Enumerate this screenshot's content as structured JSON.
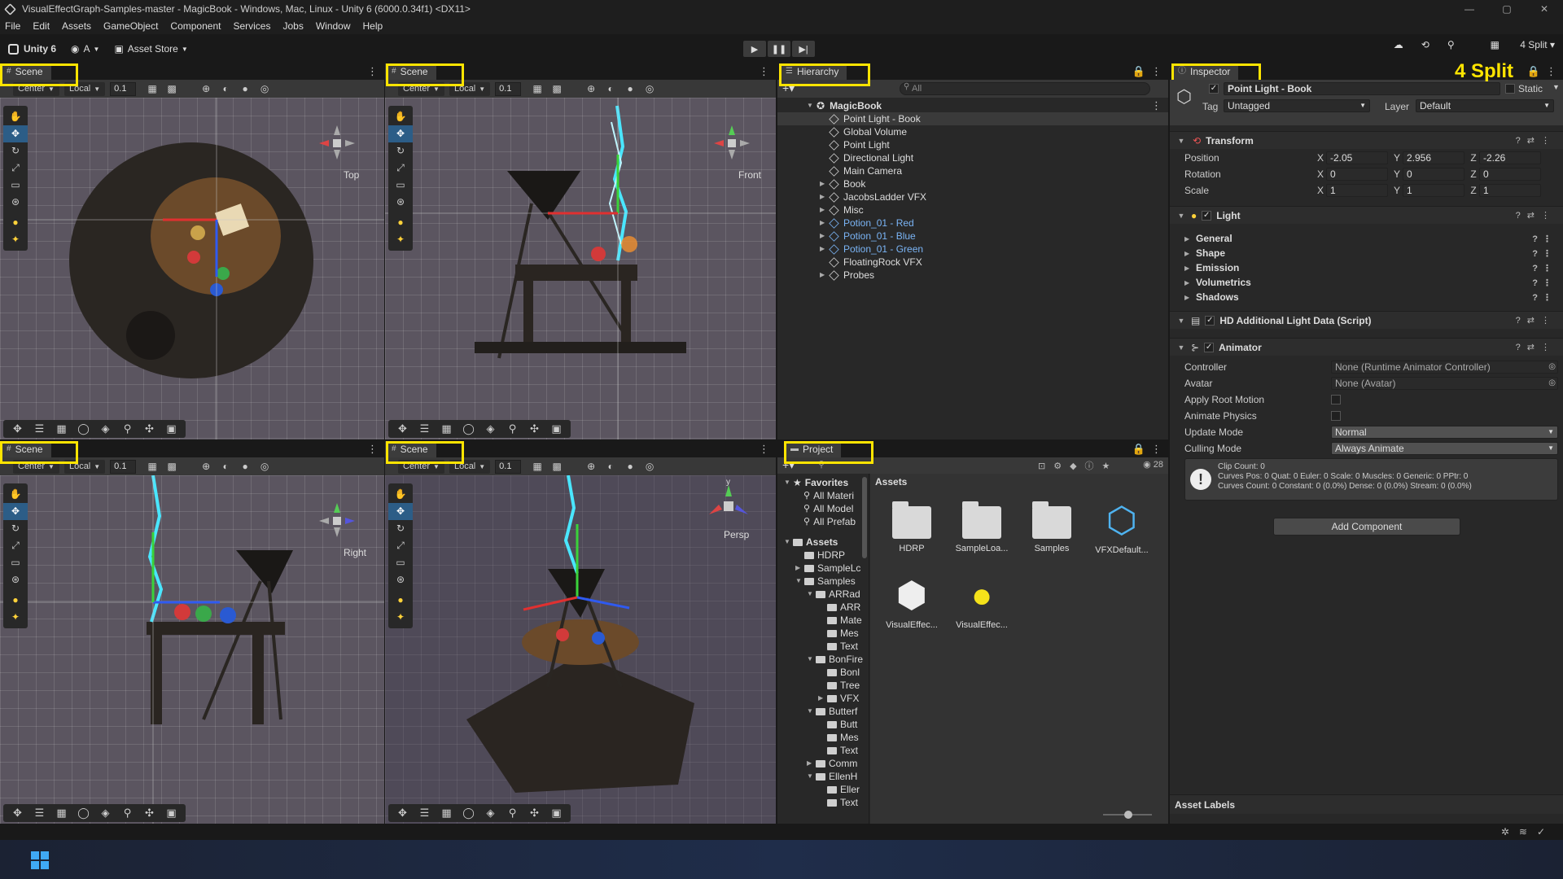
{
  "window": {
    "title": "VisualEffectGraph-Samples-master - MagicBook - Windows, Mac, Linux - Unity 6 (6000.0.34f1) <DX11>",
    "controls": [
      "—",
      "▢",
      "✕"
    ]
  },
  "menu": [
    "File",
    "Edit",
    "Assets",
    "GameObject",
    "Component",
    "Services",
    "Jobs",
    "Window",
    "Help"
  ],
  "toolbar": {
    "account": "Unity 6",
    "user": "A",
    "asset_store": "Asset Store",
    "layout": "4 Split"
  },
  "annotation": "4 Split",
  "scene_views": [
    {
      "tab": "Scene",
      "pivot": "Center",
      "space": "Local",
      "snap": "0.1",
      "gizmo_label": "Top"
    },
    {
      "tab": "Scene",
      "pivot": "Center",
      "space": "Local",
      "snap": "0.1",
      "gizmo_label": "Front"
    },
    {
      "tab": "Scene",
      "pivot": "Center",
      "space": "Local",
      "snap": "0.1",
      "gizmo_label": "Right"
    },
    {
      "tab": "Scene",
      "pivot": "Center",
      "space": "Local",
      "snap": "0.1",
      "gizmo_label": "Persp"
    }
  ],
  "hierarchy": {
    "tab": "Hierarchy",
    "search_placeholder": "All",
    "root": "MagicBook",
    "items": [
      {
        "label": "Point Light - Book",
        "expand": false,
        "prefab": false
      },
      {
        "label": "Global Volume",
        "expand": false,
        "prefab": false
      },
      {
        "label": "Point Light",
        "expand": false,
        "prefab": false
      },
      {
        "label": "Directional Light",
        "expand": false,
        "prefab": false
      },
      {
        "label": "Main Camera",
        "expand": false,
        "prefab": false
      },
      {
        "label": "Book",
        "expand": true,
        "prefab": false
      },
      {
        "label": "JacobsLadder VFX",
        "expand": true,
        "prefab": false
      },
      {
        "label": "Misc",
        "expand": true,
        "prefab": false
      },
      {
        "label": "Potion_01 - Red",
        "expand": true,
        "prefab": true
      },
      {
        "label": "Potion_01 - Blue",
        "expand": true,
        "prefab": true
      },
      {
        "label": "Potion_01 - Green",
        "expand": true,
        "prefab": true
      },
      {
        "label": "FloatingRock VFX",
        "expand": false,
        "prefab": false
      },
      {
        "label": "Probes",
        "expand": true,
        "prefab": false
      }
    ]
  },
  "inspector": {
    "tab": "Inspector",
    "object_name": "Point Light - Book",
    "static_label": "Static",
    "tag_label": "Tag",
    "tag_value": "Untagged",
    "layer_label": "Layer",
    "layer_value": "Default",
    "transform": {
      "title": "Transform",
      "position": {
        "label": "Position",
        "x": "-2.05",
        "y": "2.956",
        "z": "-2.26"
      },
      "rotation": {
        "label": "Rotation",
        "x": "0",
        "y": "0",
        "z": "0"
      },
      "scale": {
        "label": "Scale",
        "x": "1",
        "y": "1",
        "z": "1"
      },
      "axis": [
        "X",
        "Y",
        "Z"
      ]
    },
    "light": {
      "title": "Light",
      "sections": [
        "General",
        "Shape",
        "Emission",
        "Volumetrics",
        "Shadows"
      ]
    },
    "hd_light": {
      "title": "HD Additional Light Data (Script)"
    },
    "animator": {
      "title": "Animator",
      "controller_label": "Controller",
      "controller_value": "None (Runtime Animator Controller)",
      "avatar_label": "Avatar",
      "avatar_value": "None (Avatar)",
      "apply_root_motion_label": "Apply Root Motion",
      "animate_physics_label": "Animate Physics",
      "update_mode_label": "Update Mode",
      "update_mode_value": "Normal",
      "culling_mode_label": "Culling Mode",
      "culling_mode_value": "Always Animate",
      "info": [
        "Clip Count: 0",
        "Curves Pos: 0 Quat: 0 Euler: 0 Scale: 0 Muscles: 0 Generic: 0 PPtr: 0",
        "Curves Count: 0 Constant: 0 (0.0%) Dense: 0 (0.0%) Stream: 0 (0.0%)"
      ]
    },
    "add_component": "Add Component",
    "asset_labels": "Asset Labels"
  },
  "project": {
    "tab": "Project",
    "hidden_count": "28",
    "favorites_label": "Favorites",
    "favorites": [
      "All Materi",
      "All Model",
      "All Prefab"
    ],
    "assets_label": "Assets",
    "tree": [
      {
        "label": "HDRP",
        "indent": 1,
        "arrow": ""
      },
      {
        "label": "SampleLc",
        "indent": 1,
        "arrow": "▶"
      },
      {
        "label": "Samples",
        "indent": 1,
        "arrow": "▼"
      },
      {
        "label": "ARRad",
        "indent": 2,
        "arrow": "▼"
      },
      {
        "label": "ARR",
        "indent": 3,
        "arrow": ""
      },
      {
        "label": "Mate",
        "indent": 3,
        "arrow": ""
      },
      {
        "label": "Mes",
        "indent": 3,
        "arrow": ""
      },
      {
        "label": "Text",
        "indent": 3,
        "arrow": ""
      },
      {
        "label": "BonFire",
        "indent": 2,
        "arrow": "▼"
      },
      {
        "label": "Bonl",
        "indent": 3,
        "arrow": ""
      },
      {
        "label": "Tree",
        "indent": 3,
        "arrow": ""
      },
      {
        "label": "VFX",
        "indent": 3,
        "arrow": "▶"
      },
      {
        "label": "Butterf",
        "indent": 2,
        "arrow": "▼"
      },
      {
        "label": "Butt",
        "indent": 3,
        "arrow": ""
      },
      {
        "label": "Mes",
        "indent": 3,
        "arrow": ""
      },
      {
        "label": "Text",
        "indent": 3,
        "arrow": ""
      },
      {
        "label": "Comm",
        "indent": 2,
        "arrow": "▶"
      },
      {
        "label": "EllenH",
        "indent": 2,
        "arrow": "▼"
      },
      {
        "label": "Eller",
        "indent": 3,
        "arrow": ""
      },
      {
        "label": "Text",
        "indent": 3,
        "arrow": ""
      }
    ],
    "header": "Assets",
    "assets": [
      {
        "label": "HDRP",
        "kind": "folder"
      },
      {
        "label": "SampleLoa...",
        "kind": "folder"
      },
      {
        "label": "Samples",
        "kind": "folder"
      },
      {
        "label": "VFXDefault...",
        "kind": "vfx"
      },
      {
        "label": "VisualEffec...",
        "kind": "unity"
      },
      {
        "label": "VisualEffec...",
        "kind": "settings"
      }
    ]
  }
}
